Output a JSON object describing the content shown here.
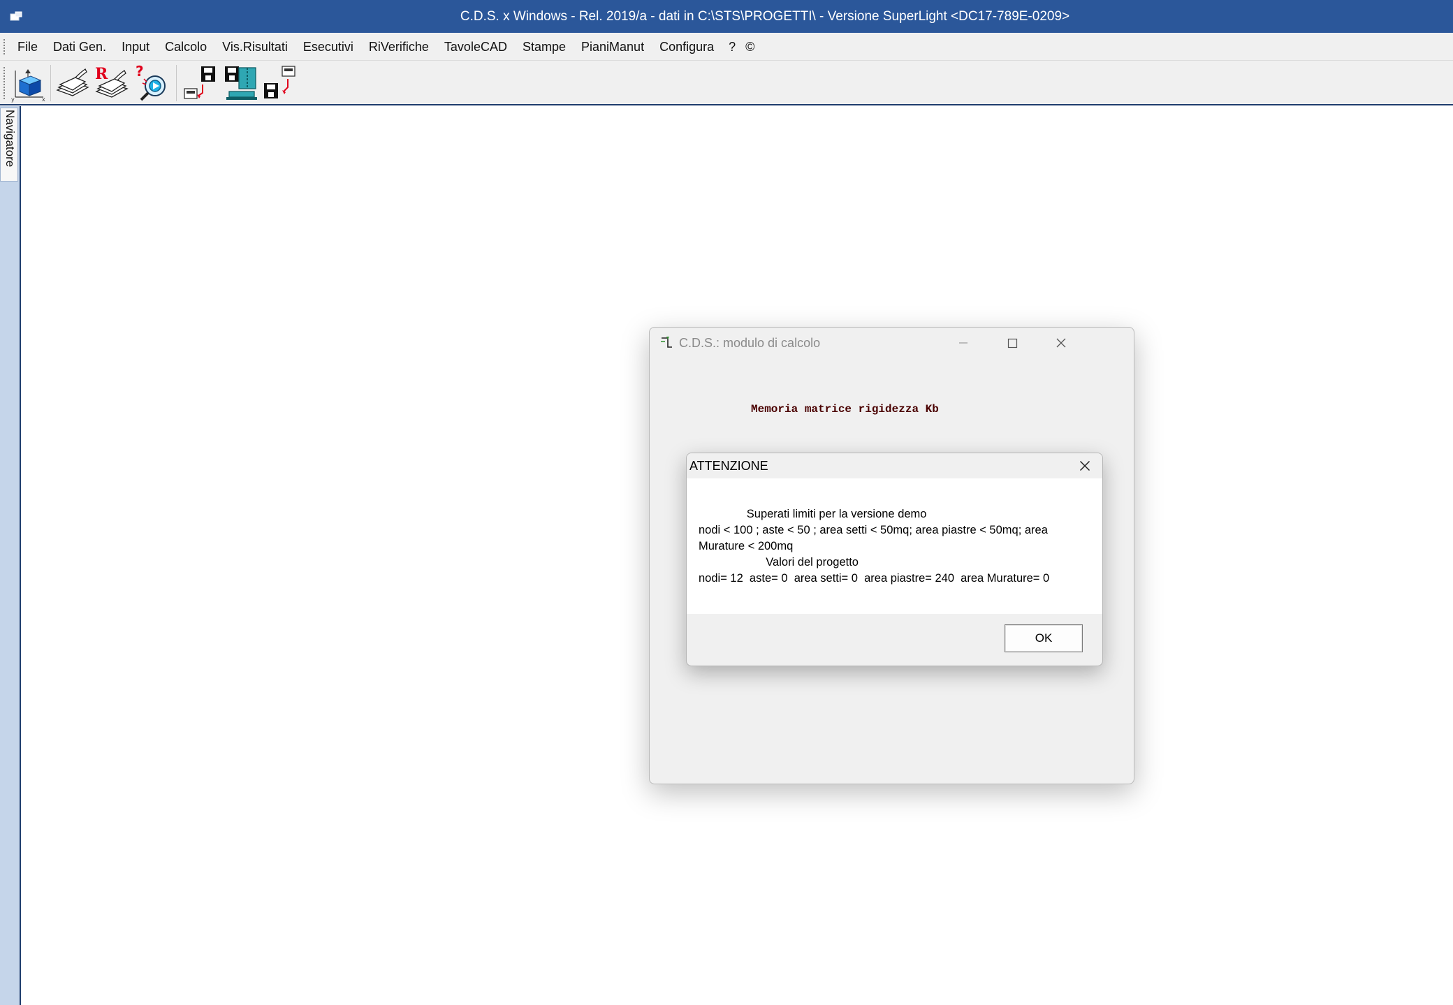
{
  "titlebar": {
    "title": "C.D.S. x Windows - Rel. 2019/a - dati in C:\\STS\\PROGETTI\\  -  Versione SuperLight  <DC17-789E-0209>"
  },
  "menu": {
    "items": [
      "File",
      "Dati Gen.",
      "Input",
      "Calcolo",
      "Vis.Risultati",
      "Esecutivi",
      "RiVerifiche",
      "TavoleCAD",
      "Stampe",
      "PianiManut",
      "Configura"
    ],
    "help": "?",
    "about": "©"
  },
  "toolbar": {
    "icons": [
      "3d-model-icon",
      "archive-icon",
      "report-icon",
      "help-inspect-icon",
      "save-to-disk-icon",
      "zip-archive-icon",
      "load-from-disk-icon"
    ]
  },
  "navigator": {
    "label": "Navigatore"
  },
  "calc_window": {
    "title": "C.D.S.: modulo di calcolo",
    "status": "Memoria matrice rigidezza Kb"
  },
  "dialog": {
    "title": "ATTENZIONE",
    "line1": "               Superati limiti per la versione demo",
    "line2": "nodi < 100 ; aste < 50 ; area setti < 50mq; area piastre < 50mq; area Murature < 200mq",
    "line3": "                     Valori del progetto",
    "line4": "nodi= 12  aste= 0  area setti= 0  area piastre= 240  area Murature= 0",
    "ok_label": "OK"
  },
  "colors": {
    "titlebar": "#2b579a",
    "chrome": "#f0f0f0",
    "navigator_strip": "#c5d5ea",
    "status_text": "#4a0000"
  }
}
